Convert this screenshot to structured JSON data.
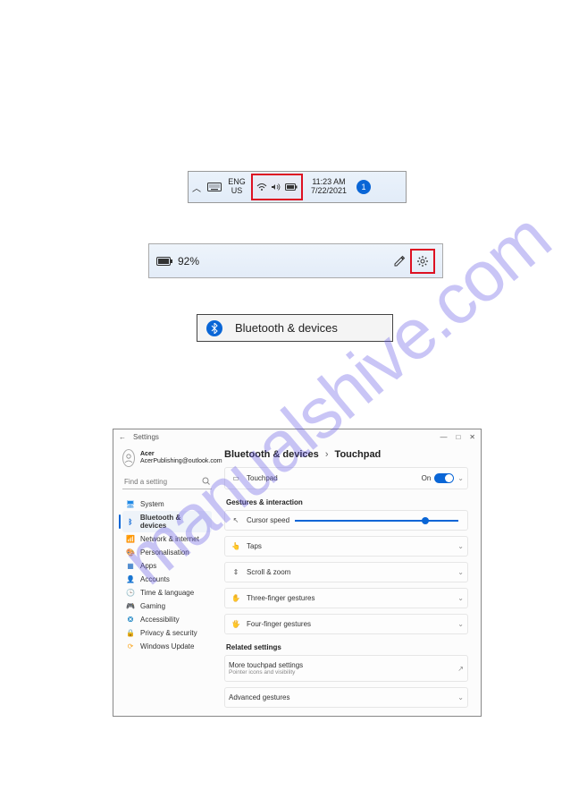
{
  "watermark": "manualshive.com",
  "taskbar": {
    "lang1": "ENG",
    "lang2": "US",
    "time": "11:23 AM",
    "date": "7/22/2021",
    "badge": "1"
  },
  "quickpanel": {
    "battery_pct": "92%"
  },
  "btd": {
    "label": "Bluetooth & devices"
  },
  "settings": {
    "back_arrow": "←",
    "title": "Settings",
    "account": {
      "name": "Acer",
      "email": "AcerPublishing@outlook.com"
    },
    "search_placeholder": "Find a setting",
    "nav": [
      {
        "icon": "🖥",
        "label": "System",
        "color": "#1e88e5"
      },
      {
        "icon": "ᛒ",
        "label": "Bluetooth & devices",
        "color": "#0a66d6",
        "selected": true
      },
      {
        "icon": "📶",
        "label": "Network & internet",
        "color": "#2e7d32"
      },
      {
        "icon": "🎨",
        "label": "Personalisation",
        "color": "#6a1b9a"
      },
      {
        "icon": "▦",
        "label": "Apps",
        "color": "#1565c0"
      },
      {
        "icon": "👤",
        "label": "Accounts",
        "color": "#ef6c00"
      },
      {
        "icon": "🕒",
        "label": "Time & language",
        "color": "#00838f"
      },
      {
        "icon": "🎮",
        "label": "Gaming",
        "color": "#c62828"
      },
      {
        "icon": "❂",
        "label": "Accessibility",
        "color": "#0277bd"
      },
      {
        "icon": "🔒",
        "label": "Privacy & security",
        "color": "#455a64"
      },
      {
        "icon": "⟳",
        "label": "Windows Update",
        "color": "#f9a825"
      }
    ],
    "crumb1": "Bluetooth & devices",
    "crumb2": "Touchpad",
    "touchpad_row": {
      "label": "Touchpad",
      "state": "On"
    },
    "sec1": "Gestures & interaction",
    "rows": [
      {
        "icon": "↖",
        "label": "Cursor speed",
        "type": "slider"
      },
      {
        "icon": "👆",
        "label": "Taps",
        "type": "expand"
      },
      {
        "icon": "⇕",
        "label": "Scroll & zoom",
        "type": "expand"
      },
      {
        "icon": "✋",
        "label": "Three-finger gestures",
        "type": "expand"
      },
      {
        "icon": "🖐",
        "label": "Four-finger gestures",
        "type": "expand"
      }
    ],
    "sec2": "Related settings",
    "related_label": "More touchpad settings",
    "related_sub": "Pointer icons and visibility",
    "advanced": "Advanced gestures"
  }
}
